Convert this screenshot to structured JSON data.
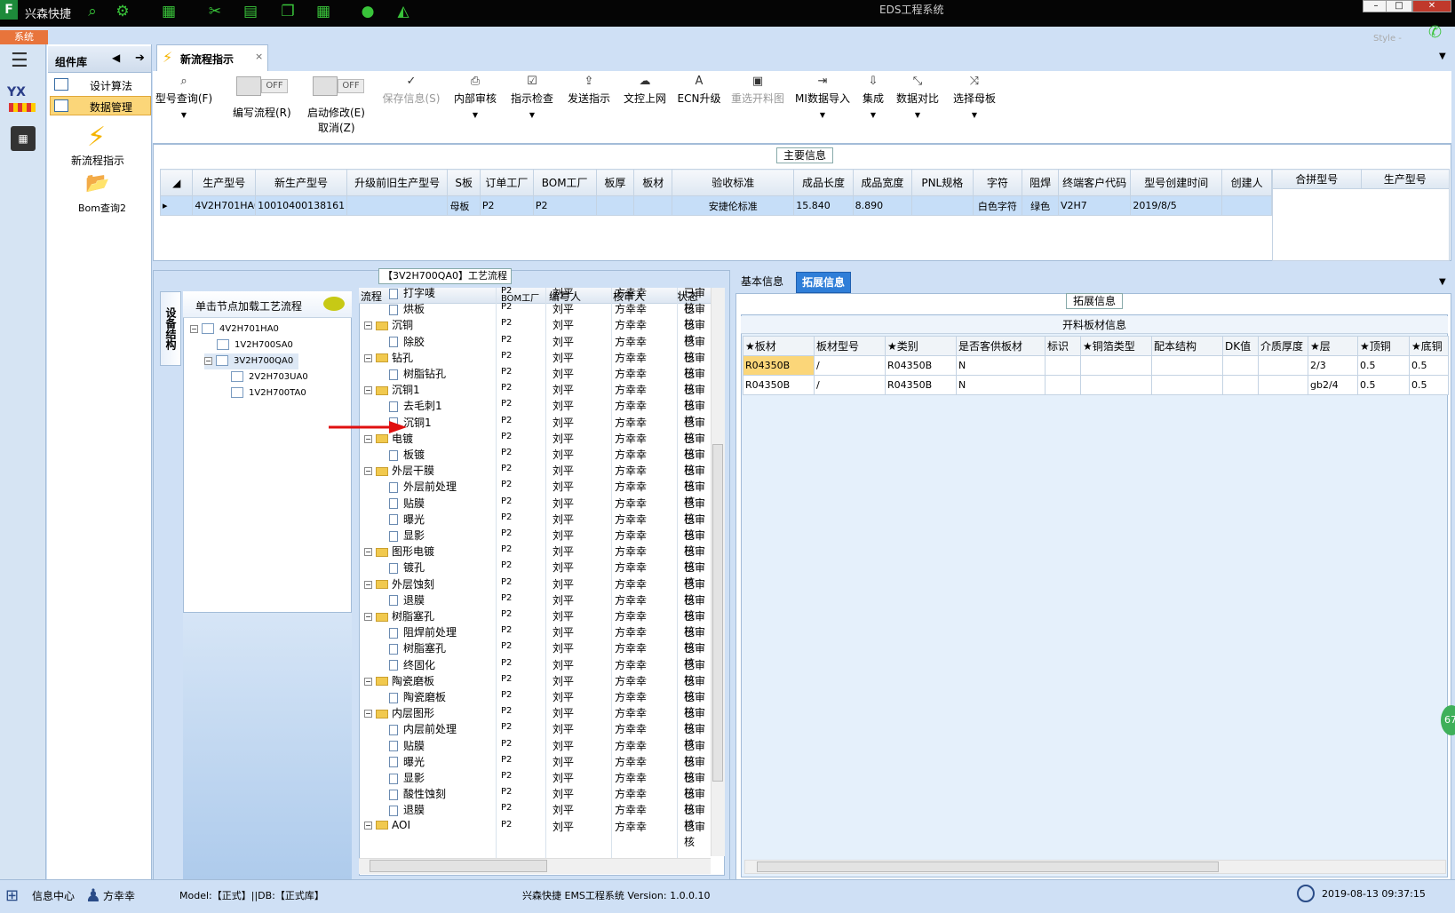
{
  "titlebar": {
    "app_icon": "F",
    "app_title": "兴森快捷",
    "window_title": "EDS工程系统",
    "minimize": "–",
    "maximize": "□",
    "close": "✕"
  },
  "system_tab": "系统",
  "style_label": "Style -",
  "left_rail": {
    "yx": "YX"
  },
  "component_library": {
    "title": "组件库",
    "items": [
      {
        "label": "设计算法"
      },
      {
        "label": "数据管理"
      }
    ],
    "shortcuts": [
      {
        "label": "新流程指示"
      },
      {
        "label": "Bom查询2"
      }
    ]
  },
  "doc_tab": {
    "label": "新流程指示",
    "close": "×"
  },
  "ribbon": {
    "b1": "型号查询(F)",
    "toggle1_state": "OFF",
    "toggle1_label": "编写流程(R)",
    "toggle2_state": "OFF",
    "toggle2_label": "启动修改(E)",
    "toggle2_sub": "取消(Z)",
    "b2": "保存信息(S)",
    "b3": "内部审核",
    "b4": "指示检查",
    "b5": "发送指示",
    "b6": "文控上网",
    "b7": "ECN升级",
    "b8": "重选开料图",
    "b9": "MI数据导入",
    "b10": "集成",
    "b11": "数据对比",
    "b12": "选择母板"
  },
  "main_info": {
    "label": "主要信息",
    "columns": [
      "生产型号",
      "新生产型号",
      "升级前旧生产型号",
      "S板",
      "订单工厂",
      "BOM工厂",
      "板厚",
      "板材",
      "验收标准",
      "成品长度",
      "成品宽度",
      "PNL规格",
      "字符",
      "阻焊",
      "终端客户代码",
      "型号创建时间",
      "创建人"
    ],
    "row": [
      "4V2H701HA0",
      "10010400138161",
      "",
      "母板",
      "P2",
      "P2",
      "",
      "",
      "安捷伦标准",
      "15.840",
      "8.890",
      "",
      "白色字符",
      "绿色",
      "V2H7",
      "2019/8/5",
      ""
    ],
    "right_columns": [
      "合拼型号",
      "生产型号"
    ]
  },
  "tree": {
    "vertical_tab": "设备结构",
    "header": "单击节点加载工艺流程",
    "nodes": [
      {
        "label": "4V2H701HA0"
      },
      {
        "label": "1V2H700SA0"
      },
      {
        "label": "3V2H700QA0"
      },
      {
        "label": "2V2H703UA0"
      },
      {
        "label": "1V2H700TA0"
      }
    ]
  },
  "process": {
    "label": "【3V2H700QA0】工艺流程",
    "columns": [
      "流程",
      "BOM工厂",
      "编写人",
      "核审人",
      "状态"
    ],
    "bom": "P2",
    "writer": "刘平",
    "reviewer": "方幸幸",
    "status": "已审核",
    "rows": [
      {
        "n": "打字唛",
        "f": 0
      },
      {
        "n": "烘板",
        "f": 0
      },
      {
        "n": "沉铜",
        "f": 1
      },
      {
        "n": "除胶",
        "f": 0
      },
      {
        "n": "钻孔",
        "f": 1
      },
      {
        "n": "树脂钻孔",
        "f": 0
      },
      {
        "n": "沉铜1",
        "f": 1
      },
      {
        "n": "去毛刺1",
        "f": 0
      },
      {
        "n": "沉铜1",
        "f": 0
      },
      {
        "n": "电镀",
        "f": 1
      },
      {
        "n": "板镀",
        "f": 0
      },
      {
        "n": "外层干膜",
        "f": 1
      },
      {
        "n": "外层前处理",
        "f": 0
      },
      {
        "n": "贴膜",
        "f": 0
      },
      {
        "n": "曝光",
        "f": 0
      },
      {
        "n": "显影",
        "f": 0
      },
      {
        "n": "图形电镀",
        "f": 1
      },
      {
        "n": "镀孔",
        "f": 0
      },
      {
        "n": "外层蚀刻",
        "f": 1
      },
      {
        "n": "退膜",
        "f": 0
      },
      {
        "n": "树脂塞孔",
        "f": 1
      },
      {
        "n": "阻焊前处理",
        "f": 0
      },
      {
        "n": "树脂塞孔",
        "f": 0
      },
      {
        "n": "终固化",
        "f": 0
      },
      {
        "n": "陶瓷磨板",
        "f": 1
      },
      {
        "n": "陶瓷磨板",
        "f": 0
      },
      {
        "n": "内层图形",
        "f": 1
      },
      {
        "n": "内层前处理",
        "f": 0
      },
      {
        "n": "贴膜",
        "f": 0
      },
      {
        "n": "曝光",
        "f": 0
      },
      {
        "n": "显影",
        "f": 0
      },
      {
        "n": "酸性蚀刻",
        "f": 0
      },
      {
        "n": "退膜",
        "f": 0
      },
      {
        "n": "AOI",
        "f": 1
      }
    ]
  },
  "right_tabs": {
    "tab1": "基本信息",
    "tab2": "拓展信息"
  },
  "ext": {
    "label": "拓展信息",
    "title": "开料板材信息",
    "columns": [
      "★板材",
      "板材型号",
      "★类别",
      "是否客供板材",
      "标识",
      "★铜箔类型",
      "配本结构",
      "DK值",
      "介质厚度",
      "★层",
      "★顶铜",
      "★底铜"
    ],
    "rows": [
      [
        "R04350B",
        "/",
        "R04350B",
        "N",
        "",
        "",
        "",
        "",
        "",
        "2/3",
        "0.5",
        "0.5"
      ],
      [
        "R04350B",
        "/",
        "R04350B",
        "N",
        "",
        "",
        "",
        "",
        "",
        "gb2/4",
        "0.5",
        "0.5"
      ]
    ]
  },
  "badge": "67",
  "status": {
    "info_center": "信息中心",
    "user": "方幸幸",
    "model": "Model:【正式】||DB:【正式库】",
    "version": "兴森快捷 EMS工程系统 Version: 1.0.0.10",
    "datetime": "2019-08-13 09:37:15"
  }
}
